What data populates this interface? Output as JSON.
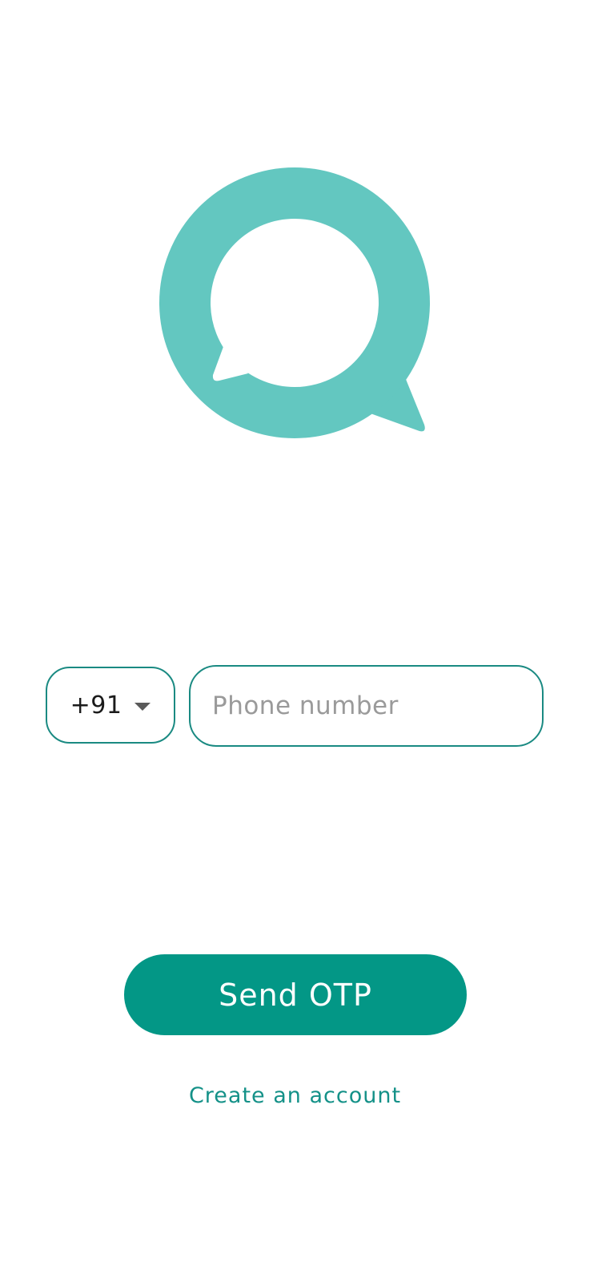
{
  "colors": {
    "logo": "#63c7c0",
    "accent": "#039786",
    "border": "#1a8a82",
    "link": "#149188",
    "placeholder": "#9a9a9a",
    "text": "#1b1b1b",
    "background": "#ffffff"
  },
  "logo": {
    "icon": "chat-bubble-logo-icon"
  },
  "country_select": {
    "value": "+91",
    "icon": "caret-down-icon"
  },
  "phone_input": {
    "value": "",
    "placeholder": "Phone number"
  },
  "send_otp_button": {
    "label": "Send OTP"
  },
  "create_account_link": {
    "label": "Create an account"
  }
}
